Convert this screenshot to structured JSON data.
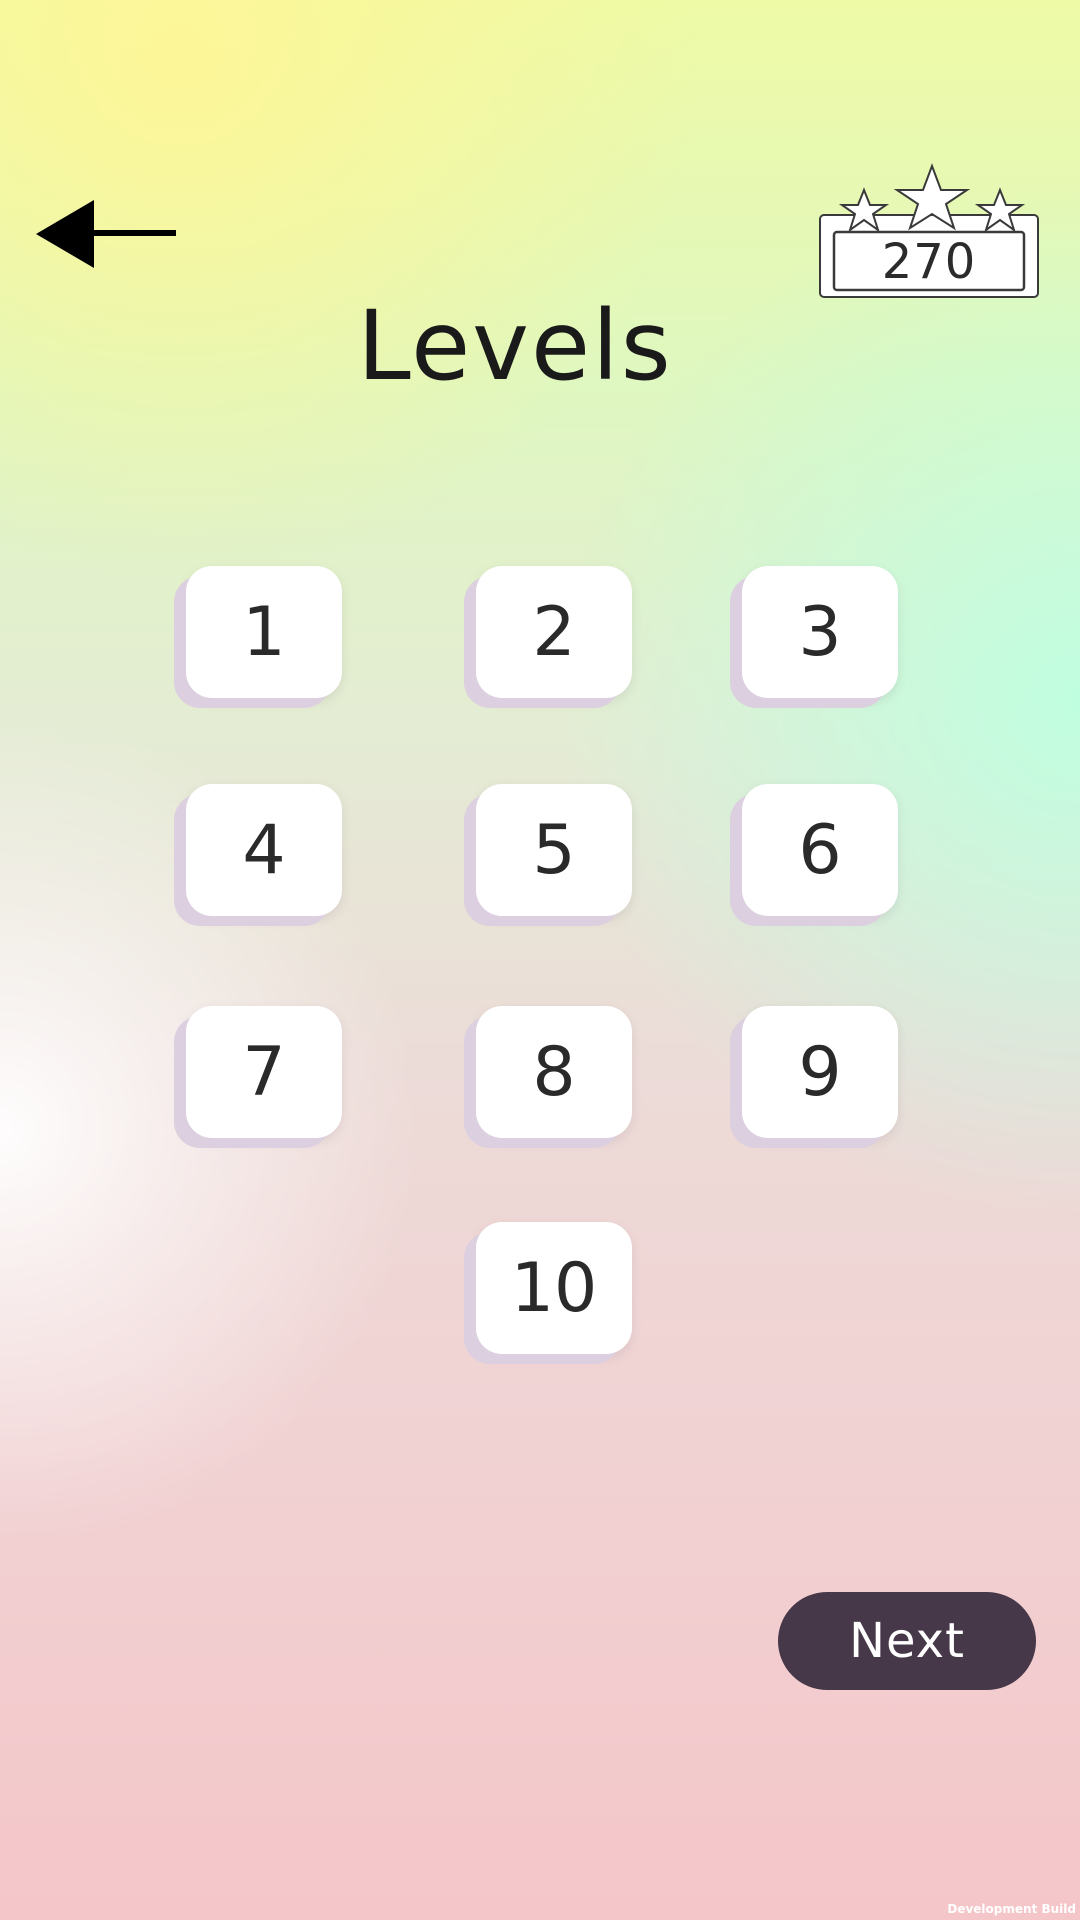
{
  "header": {
    "back_icon": "arrow-left-icon",
    "stars_icon": "three-stars-icon",
    "stars_total": "270"
  },
  "title": "Levels",
  "levels": [
    "1",
    "2",
    "3",
    "4",
    "5",
    "6",
    "7",
    "8",
    "9",
    "10"
  ],
  "footer": {
    "next_label": "Next",
    "dev_build": "Development Build"
  },
  "colors": {
    "next_button": "#463848",
    "level_button": "#ffffff",
    "level_shadow": "#dccfdf"
  }
}
